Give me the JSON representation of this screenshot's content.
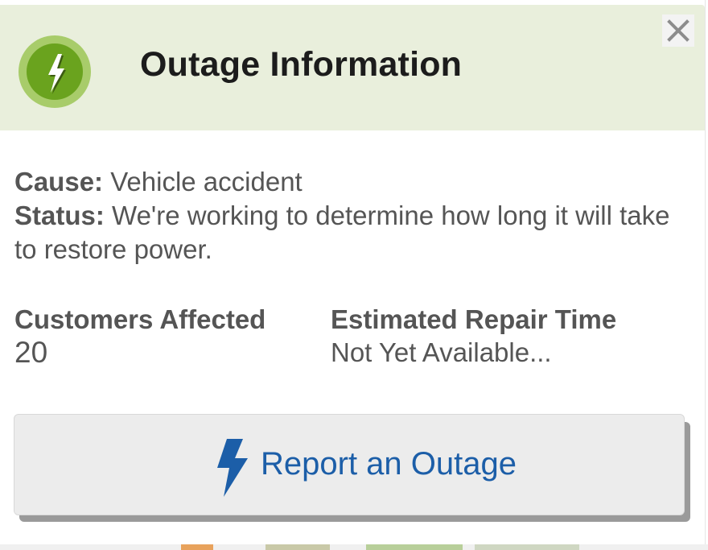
{
  "header": {
    "title": "Outage Information",
    "icon": "lightning-badge-icon",
    "close_icon": "close-icon"
  },
  "details": {
    "cause_label": "Cause:",
    "cause_value": "Vehicle accident",
    "status_label": "Status:",
    "status_value": "We're working to determine how long it will take to restore power."
  },
  "stats": {
    "customers_label": "Customers Affected",
    "customers_value": "20",
    "repair_label": "Estimated Repair Time",
    "repair_value": "Not Yet Available..."
  },
  "report_button": {
    "label": "Report an Outage",
    "icon": "lightning-bolt-icon"
  },
  "colors": {
    "header_bg": "#e9efdc",
    "icon_green": "#6aa31e",
    "icon_ring": "#a8cc6a",
    "title_text": "#1c1c1c",
    "body_text": "#555555",
    "button_bg": "#ececec",
    "button_text": "#1c5ea8",
    "button_shadow": "#9a9a9a"
  }
}
